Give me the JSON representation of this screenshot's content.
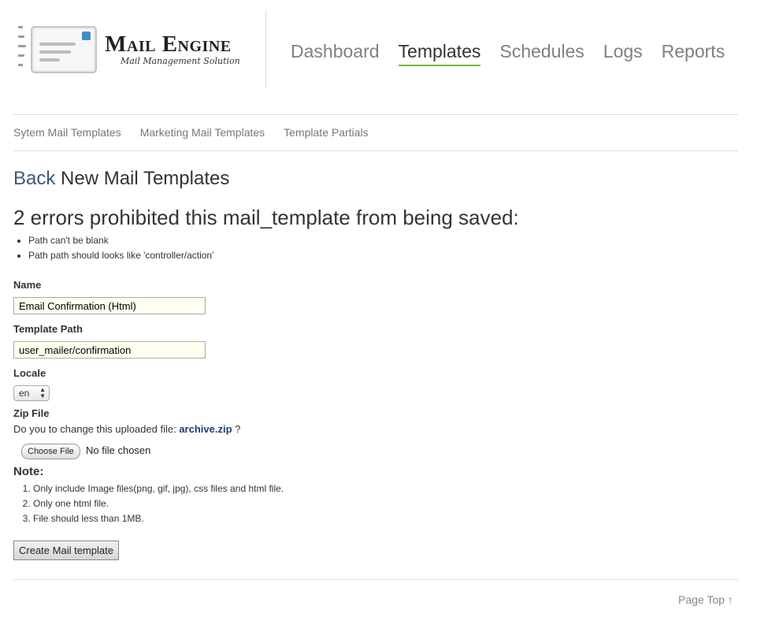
{
  "brand": {
    "title": "Mail Engine",
    "subtitle": "Mail Management Solution",
    "accent_color": "#7cb342"
  },
  "main_nav": {
    "items": [
      {
        "label": "Dashboard",
        "active": false
      },
      {
        "label": "Templates",
        "active": true
      },
      {
        "label": "Schedules",
        "active": false
      },
      {
        "label": "Logs",
        "active": false
      },
      {
        "label": "Reports",
        "active": false
      }
    ]
  },
  "sub_nav": {
    "items": [
      {
        "label": "Sytem Mail Templates"
      },
      {
        "label": "Marketing Mail Templates"
      },
      {
        "label": "Template Partials"
      }
    ]
  },
  "page": {
    "back_label": "Back",
    "title": "New Mail Templates"
  },
  "errors": {
    "title": "2 errors prohibited this mail_template from being saved:",
    "items": [
      "Path can't be blank",
      "Path path should looks like 'controller/action'"
    ]
  },
  "form": {
    "name_label": "Name",
    "name_value": "Email Confirmation (Html)",
    "path_label": "Template Path",
    "path_value": "user_mailer/confirmation",
    "locale_label": "Locale",
    "locale_value": "en",
    "zip_label": "Zip File",
    "zip_prompt": "Do you to change this uploaded file:",
    "zip_filename": "archive.zip",
    "zip_suffix": "?",
    "choose_file_label": "Choose File",
    "file_status": "No file chosen",
    "note_title": "Note:",
    "notes": [
      "Only include Image files(png, gif, jpg), css files and html file.",
      "Only one html file.",
      "File should less than 1MB."
    ],
    "submit_label": "Create Mail template"
  },
  "footer": {
    "page_top_label": "Page Top ↑"
  }
}
